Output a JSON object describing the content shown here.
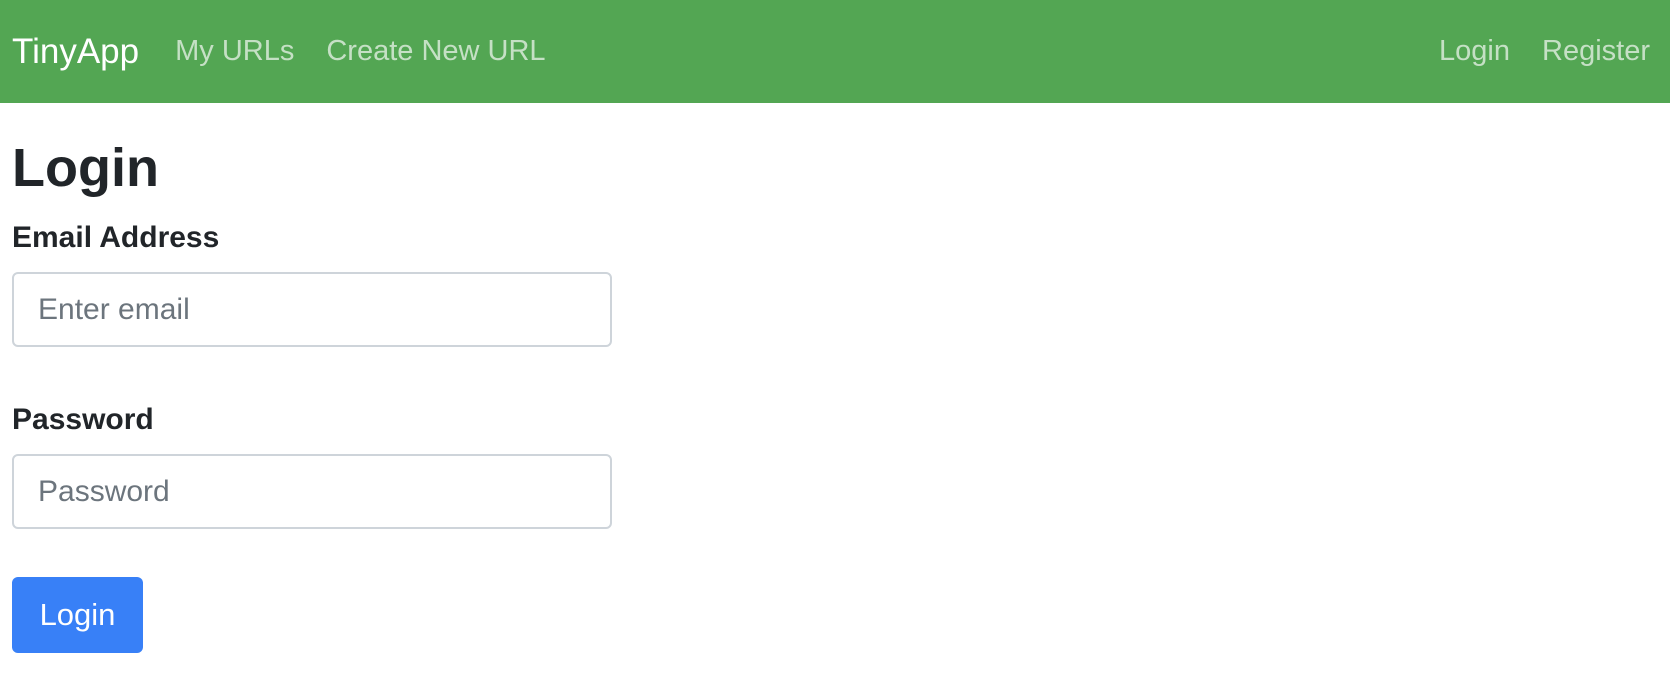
{
  "navbar": {
    "brand": "TinyApp",
    "left_links": [
      "My URLs",
      "Create New URL"
    ],
    "right_links": [
      "Login",
      "Register"
    ]
  },
  "page": {
    "title": "Login"
  },
  "form": {
    "email": {
      "label": "Email Address",
      "placeholder": "Enter email",
      "value": ""
    },
    "password": {
      "label": "Password",
      "placeholder": "Password",
      "value": ""
    },
    "submit_label": "Login"
  },
  "colors": {
    "navbar_bg": "#53a653",
    "primary_button": "#3880f7"
  }
}
